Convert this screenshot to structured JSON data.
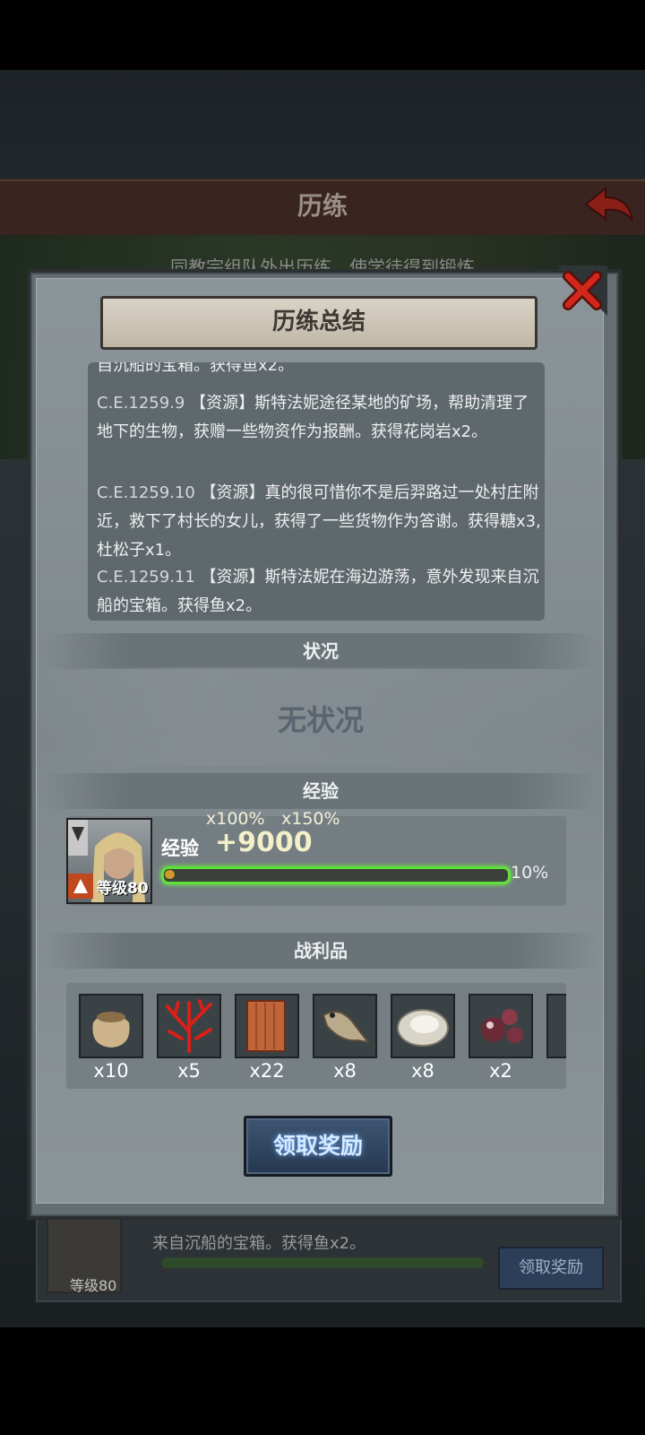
{
  "background": {
    "title": "历练",
    "notice": "同教宗组队外出历练，使学徒得到锻炼",
    "bottom_log": "来自沉船的宝箱。获得鱼x2。",
    "bottom_level": "等级80",
    "bottom_claim": "领取奖励"
  },
  "dialog": {
    "title": "历练总结",
    "log_top_partial": "自沉船的宝箱。获得鱼x2。",
    "log": [
      {
        "date": "C.E.1259.9",
        "text": "【资源】斯特法妮途径某地的矿场，帮助清理了地下的生物，获赠一些物资作为报酬。获得花岗岩x2。"
      },
      {
        "date": "C.E.1259.10",
        "text": "【资源】真的很可惜你不是后羿路过一处村庄附近，救下了村长的女儿，获得了一些货物作为答谢。获得糖x3, 杜松子x1。"
      },
      {
        "date": "C.E.1259.11",
        "text": "【资源】斯特法妮在海边游荡，意外发现来自沉船的宝箱。获得鱼x2。"
      }
    ],
    "status_label": "状况",
    "status_value": "无状况",
    "exp_section_label": "经验",
    "exp_multiplier_1": "x100%",
    "exp_multiplier_2": "x150%",
    "exp_label": "经验",
    "exp_value": "+9000",
    "exp_percent": "10%",
    "exp_progress": 0.03,
    "hero_level": "等级80",
    "loot_label": "战利品",
    "loot": [
      {
        "icon": "sack-icon",
        "qty": "x10"
      },
      {
        "icon": "coral-icon",
        "qty": "x5"
      },
      {
        "icon": "wood-plank-icon",
        "qty": "x22"
      },
      {
        "icon": "fish-icon",
        "qty": "x8"
      },
      {
        "icon": "oyster-icon",
        "qty": "x8"
      },
      {
        "icon": "pearl-icon",
        "qty": "x2"
      },
      {
        "icon": "item-icon",
        "qty": "x"
      }
    ],
    "claim_button": "领取奖励"
  },
  "colors": {
    "exp_bar_glow": "#5ee03c",
    "claim_button": "#2d425e"
  }
}
